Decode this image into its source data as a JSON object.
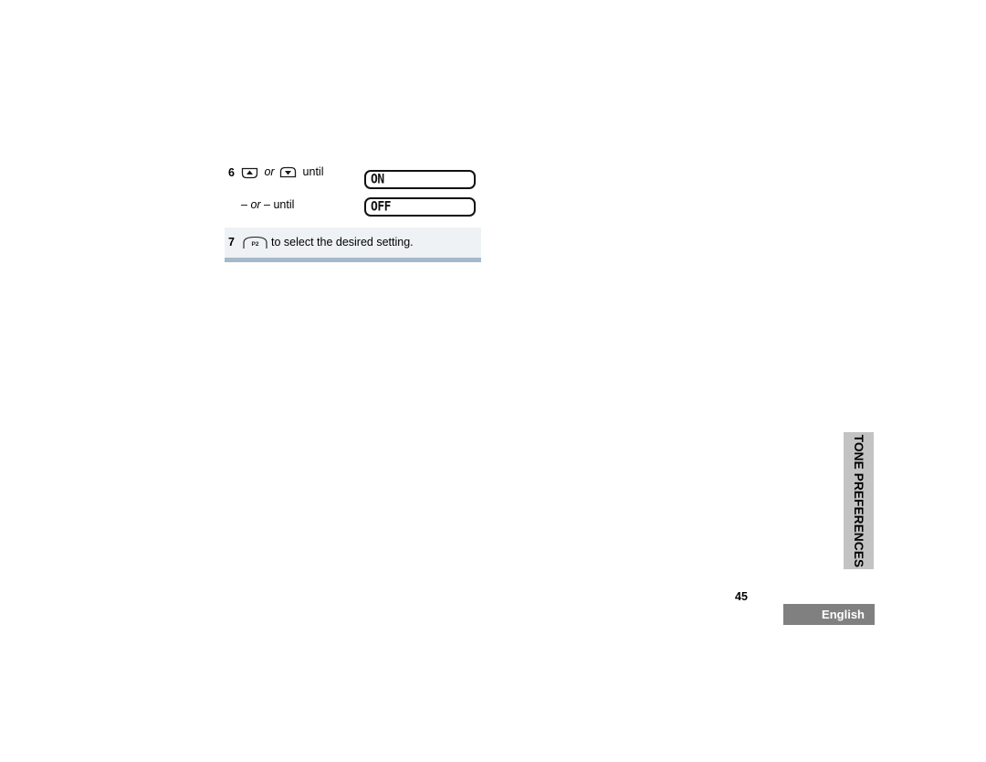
{
  "page": {
    "number": "45",
    "language_badge": "English",
    "side_tab": "TONE PREFERENCES"
  },
  "procedure": {
    "steps": [
      {
        "number": "6",
        "key_up_icon": "up-arrow-key-icon",
        "connector": " or ",
        "key_down_icon": "down-arrow-key-icon",
        "trailing": " until",
        "display": "ON"
      },
      {
        "number": "",
        "alt_text": "– or – until",
        "alt_italic": "or",
        "alt_prefix": "– ",
        "alt_suffix": " – until",
        "display": "OFF"
      },
      {
        "number": "7",
        "key_icon": "p2-key-icon",
        "key_label": "P2",
        "text": "to select the desired setting."
      }
    ]
  },
  "colors": {
    "highlight_row_bg": "#eef2f5",
    "highlight_row_border": "#a6bacb",
    "side_tab_bg": "#c3c3c3",
    "badge_bg": "#808080",
    "badge_text": "#ffffff",
    "lcd_border": "#111111"
  }
}
